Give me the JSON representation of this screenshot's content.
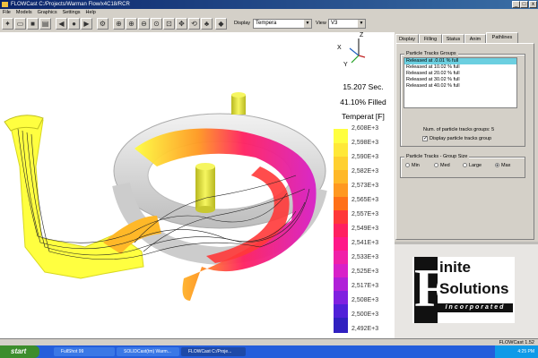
{
  "window": {
    "title": "FLOWCast   C:/Projects/Warman Flow/x4C18/RCR",
    "min": "_",
    "max": "□",
    "close": "x"
  },
  "menu": [
    "File",
    "Models",
    "Graphics",
    "Settings",
    "Help"
  ],
  "toolbar": {
    "display_label": "Display",
    "display_value": "Tempera",
    "view_label": "View",
    "view_value": "V3"
  },
  "sim": {
    "time": "15.207 Sec.",
    "filled": "41.10% Filled",
    "quantity": "Temperat [F]"
  },
  "axes": {
    "z": "Z",
    "x": "X",
    "y": "Y"
  },
  "legend": {
    "values": [
      "2,608E+3",
      "2,598E+3",
      "2,590E+3",
      "2,582E+3",
      "2,573E+3",
      "2,565E+3",
      "2,557E+3",
      "2,549E+3",
      "2,541E+3",
      "2,533E+3",
      "2,525E+3",
      "2,517E+3",
      "2,508E+3",
      "2,500E+3",
      "2,492E+3"
    ],
    "colors": [
      "#ffff40",
      "#ffe838",
      "#ffd030",
      "#ffb828",
      "#ff9820",
      "#ff7018",
      "#ff3838",
      "#ff2060",
      "#ff1888",
      "#f020a8",
      "#d820c8",
      "#b020d8",
      "#8020e0",
      "#5020d8",
      "#3020c0"
    ]
  },
  "panel": {
    "tabs": [
      "Display",
      "Filling",
      "Status",
      "Anim",
      "Pathlines"
    ],
    "active_tab": "Pathlines",
    "groups_title": "Particle Tracks Groups",
    "groups": [
      "Released at  .0.01 % full",
      "Released at  10.02 % full",
      "Released at  20.02 % full",
      "Released at  30.02 % full",
      "Released at  40.02 % full"
    ],
    "selected_index": 0,
    "num_groups_label": "Num. of particle tracks groups: 5",
    "display_group_label": "Display particle tracks group",
    "display_group_checked": true,
    "size_title": "Particle Tracks - Group Size",
    "sizes": [
      "Min",
      "Med",
      "Large",
      "Max"
    ],
    "selected_size": "Max"
  },
  "logo": {
    "line1": "inite",
    "line2": "Solutions",
    "line3": "Incorporated",
    "letter": "F"
  },
  "status": {
    "right": "FLOWCast 1.52"
  },
  "taskbar": {
    "start": "start",
    "tasks": [
      "FullShot 99",
      "SOLIDCast(tm) Warm...",
      "FLOWCast   C:/Proje..."
    ],
    "active_index": 2,
    "clock": "4:25 PM"
  },
  "colors": {
    "accent": "#0a246a",
    "highlight": "#6ccfe0",
    "casting_hot": "#ffff40",
    "casting_cool": "#d820c8"
  }
}
